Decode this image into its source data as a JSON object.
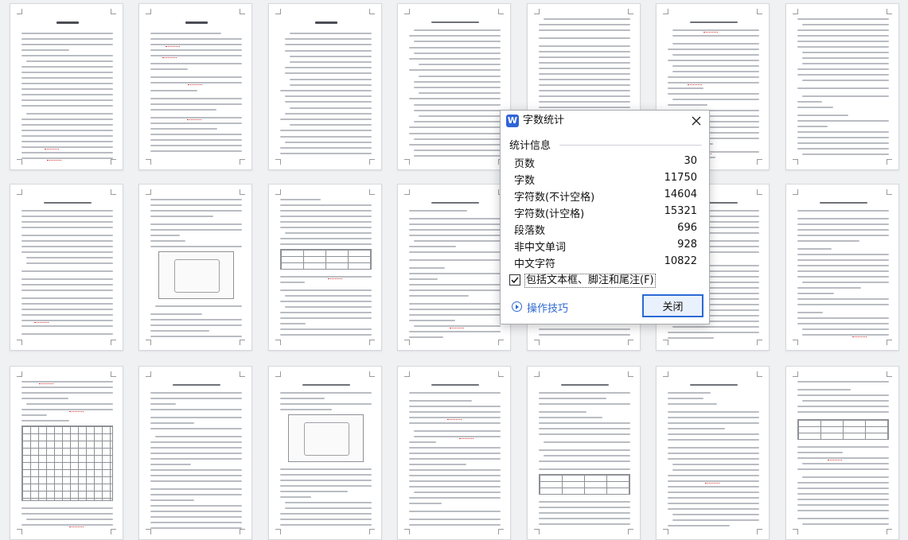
{
  "dialog": {
    "app_icon_letter": "W",
    "title": "字数统计",
    "section_label": "统计信息",
    "stats": [
      {
        "label": "页数",
        "value": "30"
      },
      {
        "label": "字数",
        "value": "11750"
      },
      {
        "label": "字符数(不计空格)",
        "value": "14604"
      },
      {
        "label": "字符数(计空格)",
        "value": "15321"
      },
      {
        "label": "段落数",
        "value": "696"
      },
      {
        "label": "非中文单词",
        "value": "928"
      },
      {
        "label": "中文字符",
        "value": "10822"
      }
    ],
    "checkbox": {
      "label": "包括文本框、脚注和尾注(F)",
      "checked": true
    },
    "tips_link": "操作技巧",
    "close_button": "关闭"
  },
  "colors": {
    "accent": "#2f64d8",
    "link": "#2f6ad0",
    "background": "#f0f1f3",
    "spell_squiggle": "#d23b3b"
  },
  "thumbnails": {
    "rows": 3,
    "columns": 7,
    "page_titles": [
      "摘 要",
      "Abstract",
      "目 录"
    ],
    "keywords_label_cn": "关键词：",
    "keywords_label_en": "Keywords:"
  }
}
